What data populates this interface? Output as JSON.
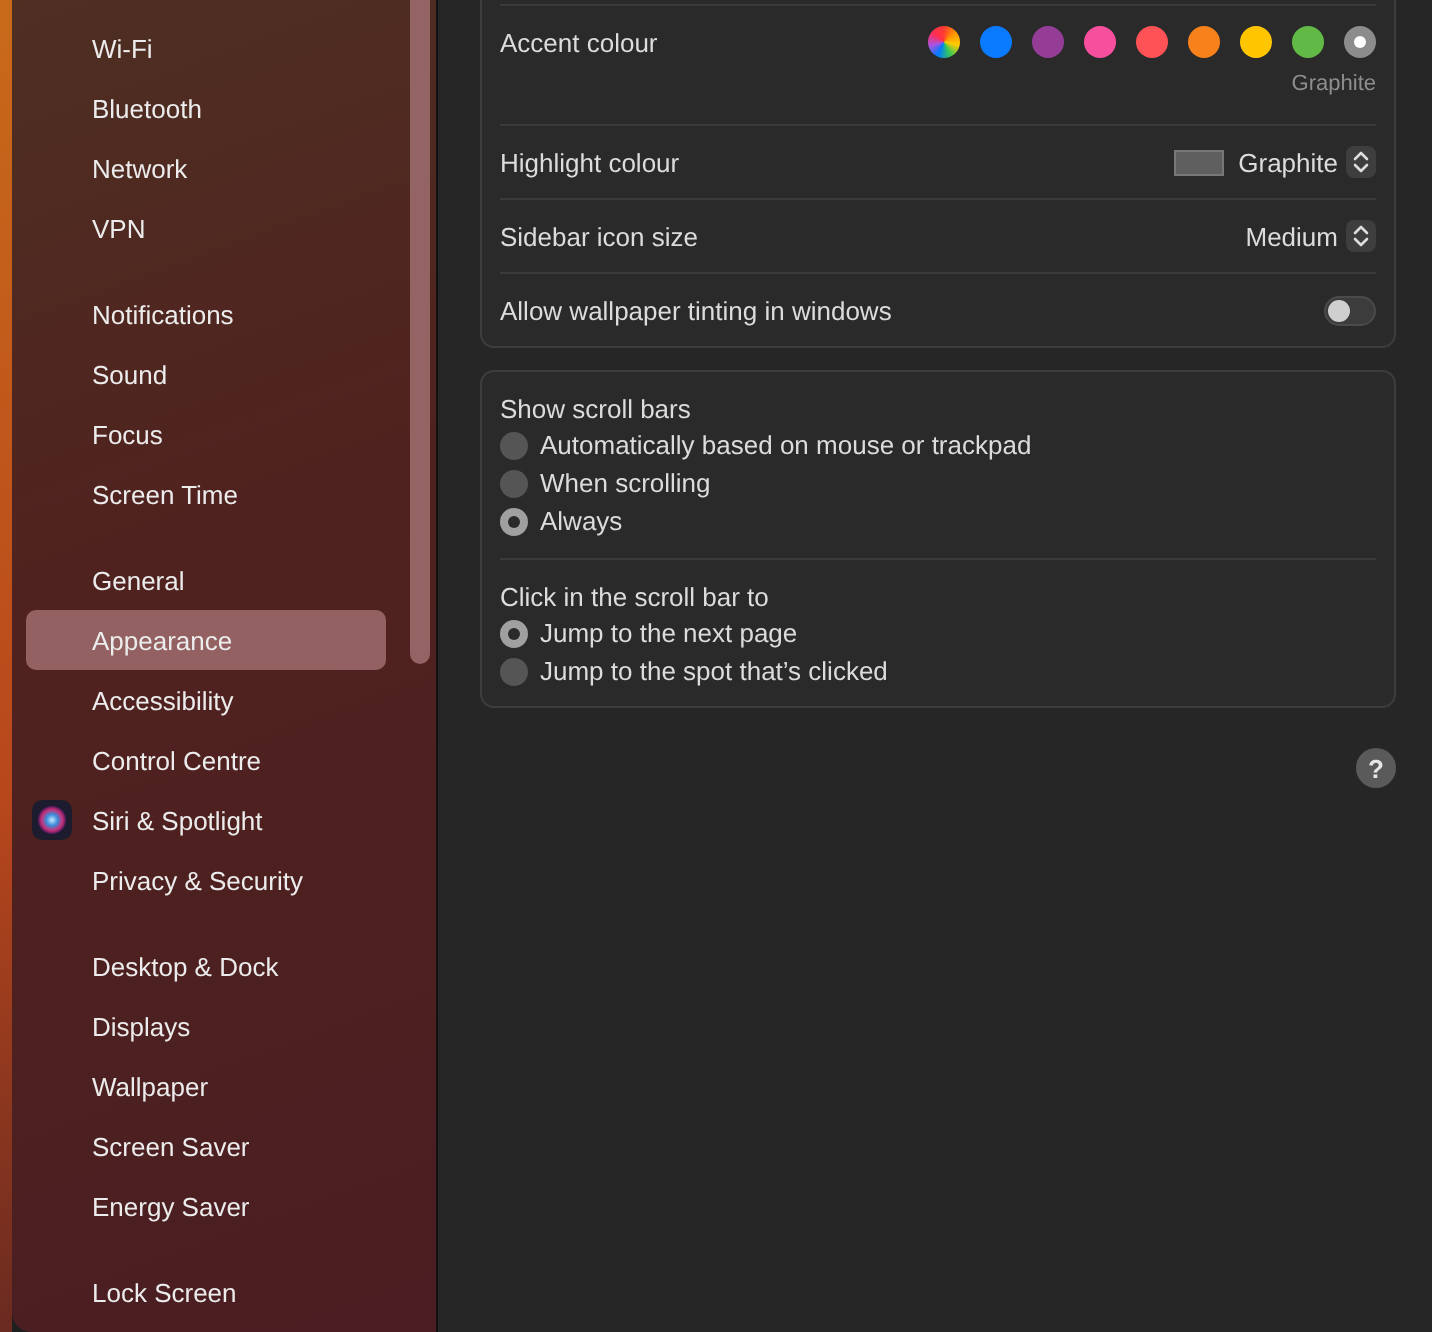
{
  "sidebar": {
    "groups": [
      {
        "items": [
          {
            "label": "Wi-Fi",
            "selected": false,
            "kind": "plain"
          },
          {
            "label": "Bluetooth",
            "selected": false,
            "kind": "plain"
          },
          {
            "label": "Network",
            "selected": false,
            "kind": "plain"
          },
          {
            "label": "VPN",
            "selected": false,
            "kind": "plain"
          }
        ]
      },
      {
        "items": [
          {
            "label": "Notifications",
            "selected": false,
            "kind": "plain"
          },
          {
            "label": "Sound",
            "selected": false,
            "kind": "plain"
          },
          {
            "label": "Focus",
            "selected": false,
            "kind": "plain"
          },
          {
            "label": "Screen Time",
            "selected": false,
            "kind": "plain"
          }
        ]
      },
      {
        "items": [
          {
            "label": "General",
            "selected": false,
            "kind": "plain"
          },
          {
            "label": "Appearance",
            "selected": true,
            "kind": "plain"
          },
          {
            "label": "Accessibility",
            "selected": false,
            "kind": "plain"
          },
          {
            "label": "Control Centre",
            "selected": false,
            "kind": "plain"
          },
          {
            "label": "Siri & Spotlight",
            "selected": false,
            "kind": "iconic"
          },
          {
            "label": "Privacy & Security",
            "selected": false,
            "kind": "plain"
          }
        ]
      },
      {
        "items": [
          {
            "label": "Desktop & Dock",
            "selected": false,
            "kind": "plain"
          },
          {
            "label": "Displays",
            "selected": false,
            "kind": "plain"
          },
          {
            "label": "Wallpaper",
            "selected": false,
            "kind": "plain"
          },
          {
            "label": "Screen Saver",
            "selected": false,
            "kind": "plain"
          },
          {
            "label": "Energy Saver",
            "selected": false,
            "kind": "plain"
          }
        ]
      },
      {
        "items": [
          {
            "label": "Lock Screen",
            "selected": false,
            "kind": "plain"
          }
        ]
      }
    ]
  },
  "appearance": {
    "accent": {
      "label": "Accent colour",
      "caption": "Graphite",
      "colors": [
        {
          "kind": "multicolour",
          "selected": false
        },
        {
          "kind": "solid",
          "color": "#0a7aff",
          "selected": false
        },
        {
          "kind": "solid",
          "color": "#953d96",
          "selected": false
        },
        {
          "kind": "solid",
          "color": "#f74f9e",
          "selected": false
        },
        {
          "kind": "solid",
          "color": "#ff5257",
          "selected": false
        },
        {
          "kind": "solid",
          "color": "#f7821b",
          "selected": false
        },
        {
          "kind": "solid",
          "color": "#ffc600",
          "selected": false
        },
        {
          "kind": "solid",
          "color": "#62ba46",
          "selected": false
        },
        {
          "kind": "solid",
          "color": "#8c8c8c",
          "selected": true
        }
      ]
    },
    "highlight": {
      "label": "Highlight colour",
      "color": "#5f5f5f",
      "value": "Graphite"
    },
    "icon_size": {
      "label": "Sidebar icon size",
      "value": "Medium"
    },
    "tinting": {
      "label": "Allow wallpaper tinting in windows",
      "on": false
    }
  },
  "scroll_bars": {
    "groups": [
      {
        "title": "Show scroll bars",
        "options": [
          {
            "label": "Automatically based on mouse or trackpad",
            "selected": false
          },
          {
            "label": "When scrolling",
            "selected": false
          },
          {
            "label": "Always",
            "selected": true
          }
        ]
      },
      {
        "title": "Click in the scroll bar to",
        "options": [
          {
            "label": "Jump to the next page",
            "selected": true
          },
          {
            "label": "Jump to the spot that’s clicked",
            "selected": false
          }
        ]
      }
    ]
  },
  "help": {
    "label": "?"
  }
}
